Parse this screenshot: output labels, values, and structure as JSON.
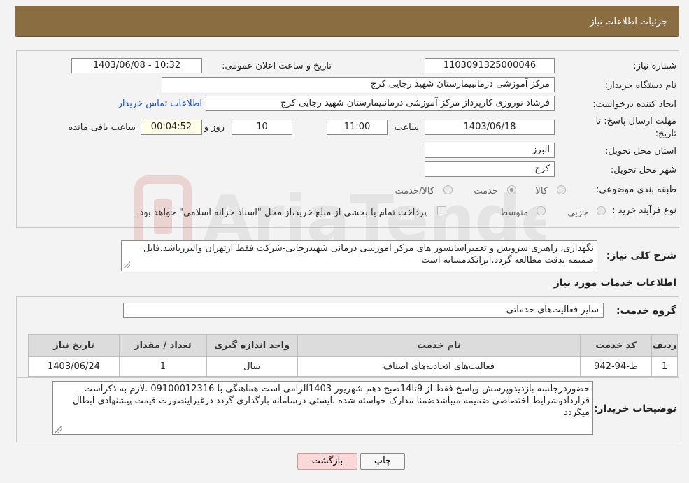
{
  "header": {
    "title": "جزئیات اطلاعات نیاز"
  },
  "form": {
    "need_number_label": "شماره نیاز:",
    "need_number": "1103091325000046",
    "announce_label": "تاریخ و ساعت اعلان عمومی:",
    "announce_value": "1403/06/08 - 10:32",
    "buyer_label": "نام دستگاه خریدار:",
    "buyer_value": "مرکز آموزشی درمانبیمارستان شهید رجایی کرج",
    "creator_label": "ایجاد کننده درخواست:",
    "creator_value": "فرشاد نوروزی کارپرداز مرکز آموزشی درمانبیمارستان شهید رجایی کرج",
    "contact_link": "اطلاعات تماس خریدار",
    "deadline_label_1": "مهلت ارسال پاسخ: تا",
    "deadline_label_2": "تاریخ:",
    "deadline_date": "1403/06/18",
    "time_label": "ساعت",
    "deadline_time": "11:00",
    "days_value": "10",
    "days_label": "روز و",
    "remaining_value": "00:04:52",
    "remaining_label": "ساعت باقی مانده",
    "province_label": "استان محل تحویل:",
    "province_value": "البرز",
    "city_label": "شهر محل تحویل:",
    "city_value": "کرج",
    "category_label": "طبقه بندی موضوعی:",
    "category_options": [
      "کالا",
      "خدمت",
      "کالا/خدمت"
    ],
    "category_selected_index": 1,
    "process_label": "نوع فرآیند خرید :",
    "process_options": [
      "جزیی",
      "متوسط"
    ],
    "payment_text": "پرداخت تمام یا بخشی از مبلغ خرید،از محل \"اسناد خزانه اسلامی\" خواهد بود."
  },
  "summary": {
    "label": "شرح کلی نیاز:",
    "text": "نگهداری، راهبری سرویس و تعمیرآسانسور های مرکز آموزشی درمانی شهیدرجایی-شرکت فقط ازتهران والبرزباشد.فایل ضمیمه بدقت مطالعه گردد.ایرانکدمشابه است"
  },
  "services": {
    "section_title": "اطلاعات خدمات مورد نیاز",
    "group_label": "گروه خدمت:",
    "group_value": "سایر فعالیت‌های خدماتی",
    "columns": [
      "ردیف",
      "کد خدمت",
      "نام خدمت",
      "واحد اندازه گیری",
      "تعداد / مقدار",
      "تاریخ نیاز"
    ],
    "rows": [
      [
        "1",
        "ط-94-942",
        "فعالیت‌های اتحادیه‌های اصناف",
        "سال",
        "1",
        "1403/06/24"
      ]
    ]
  },
  "buyer_notes": {
    "label": "توضیحات خریدار:",
    "text": "حضوردرجلسه بازدیدوپرسش وپاسخ فقط از 9تا14صبح  دهم شهریور 1403الزامی است هماهنگی با  09100012316  .لازم به ذکراست قراردادوشرایط اختصاصی ضمیمه میباشدضمنا مدارک خواسته شده بایستی درسامانه بارگذاری گردد درغیراینصورت قیمت پیشنهادی ابطال میگردد"
  },
  "buttons": {
    "print": "چاپ",
    "back": "بازگشت"
  },
  "watermark": "AriaTender.neT",
  "colors": {
    "header_bg": "#8a6d40",
    "link": "#1a4fcf",
    "back_btn": "#fbd8d8"
  }
}
